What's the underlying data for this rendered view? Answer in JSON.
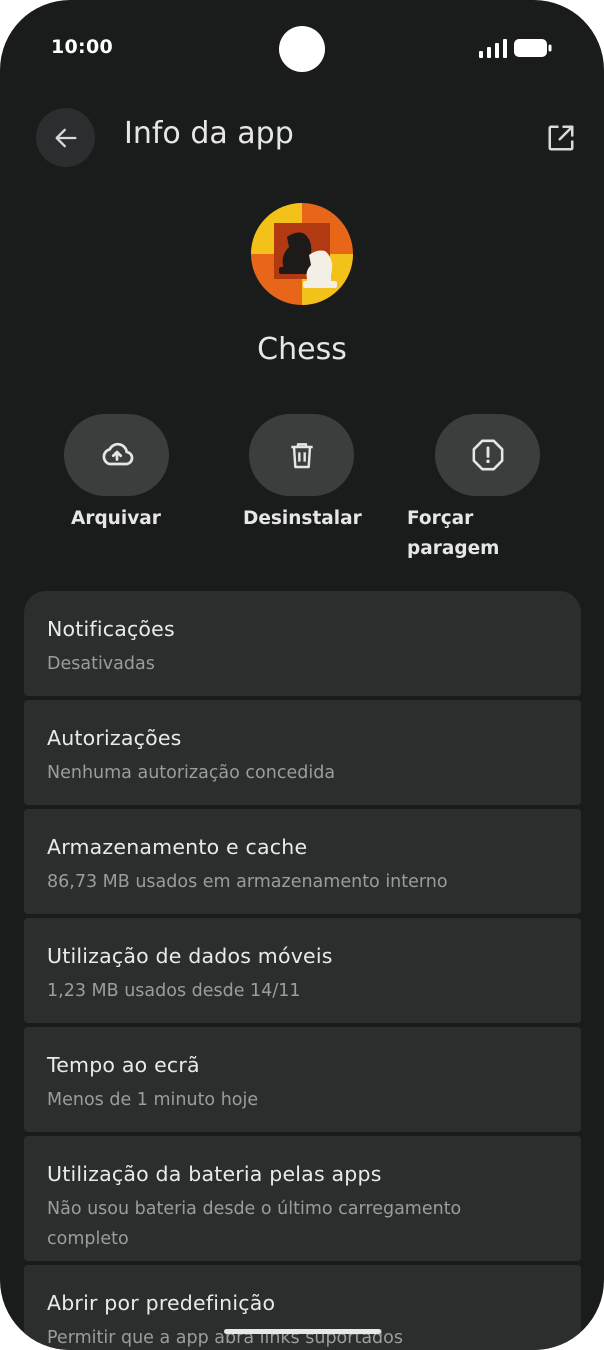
{
  "status_bar": {
    "time": "10:00"
  },
  "header": {
    "title": "Info da app",
    "back_icon": "arrow-left-icon",
    "open_icon": "open-in-new-icon"
  },
  "app": {
    "name": "Chess",
    "icon": "chess-knight-icon"
  },
  "actions": [
    {
      "label": "Arquivar",
      "icon": "cloud-upload-icon"
    },
    {
      "label": "Desinstalar",
      "icon": "trash-icon"
    },
    {
      "label_line1": "Forçar",
      "label_line2": "paragem",
      "icon": "alert-circle-icon"
    }
  ],
  "settings": [
    {
      "title": "Notificações",
      "subtitle": "Desativadas"
    },
    {
      "title": "Autorizações",
      "subtitle": "Nenhuma autorização concedida"
    },
    {
      "title": "Armazenamento e cache",
      "subtitle": "86,73 MB usados em armazenamento interno"
    },
    {
      "title": "Utilização de dados móveis",
      "subtitle": "1,23 MB usados desde 14/11"
    },
    {
      "title": "Tempo ao ecrã",
      "subtitle": "Menos de 1 minuto hoje"
    },
    {
      "title": "Utilização da bateria pelas apps",
      "subtitle_line1": "Não usou bateria desde o último carregamento",
      "subtitle_line2": "completo"
    },
    {
      "title": "Abrir por predefinição",
      "subtitle": "Permitir que a app abra links suportados"
    }
  ],
  "colors": {
    "background": "#1a1c1c",
    "card": "#2c2e2e",
    "action_button": "#3a3f3e",
    "accent_orange": "#e8661a",
    "accent_yellow": "#f2c21b"
  }
}
